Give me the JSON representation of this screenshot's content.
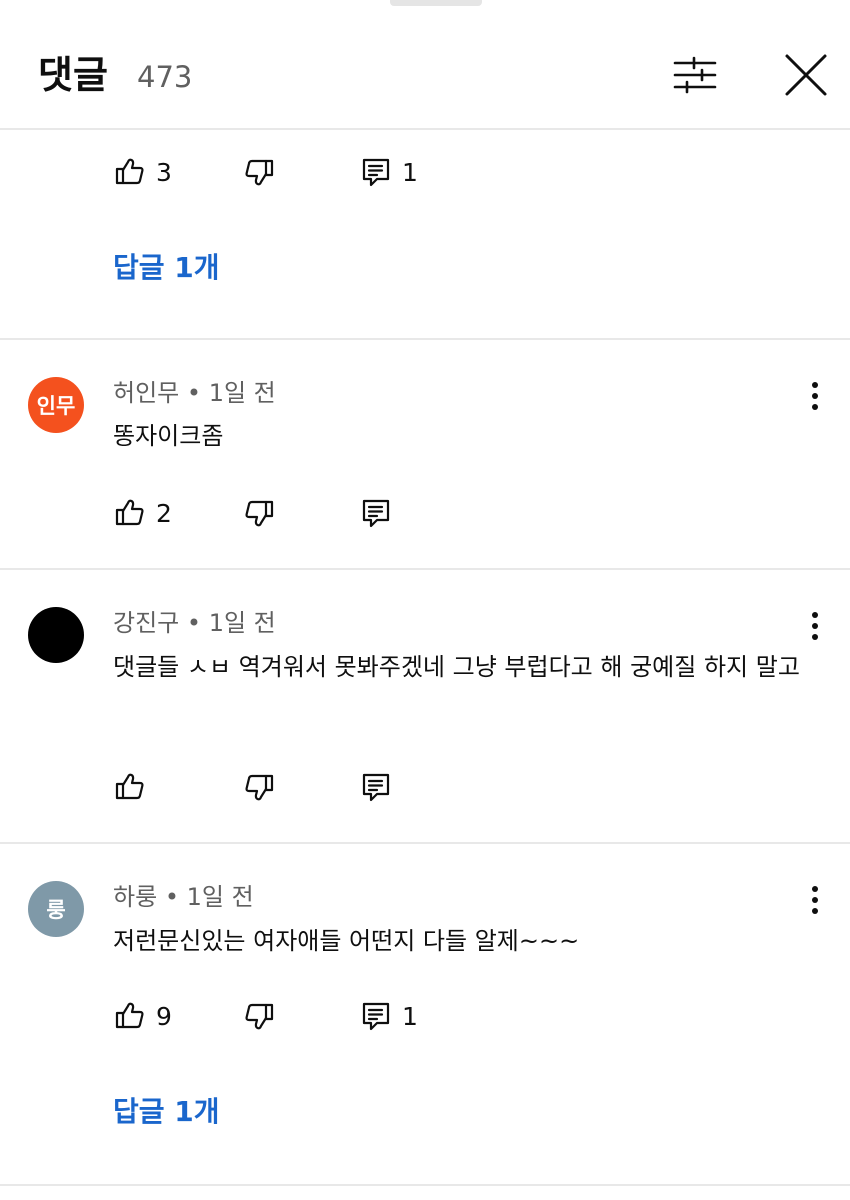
{
  "header": {
    "title": "댓글",
    "count": "473"
  },
  "top_partial": {
    "likes": "3",
    "replies": "1",
    "replies_link": "답글 1개"
  },
  "comments": [
    {
      "initials": "인무",
      "avatar_color": "#f4511e",
      "author": "허인무",
      "time": "1일 전",
      "text": "똥자이크좀",
      "likes": "2",
      "replies": ""
    },
    {
      "initials": "",
      "avatar_color": "#000000",
      "author": "강진구",
      "time": "1일 전",
      "text": "댓글들 ㅅㅂ 역겨워서 못봐주겠네 그냥 부럽다고 해 궁예질 하지 말고",
      "likes": "",
      "replies": ""
    },
    {
      "initials": "룽",
      "avatar_color": "#7f99a8",
      "author": "하룽",
      "time": "1일 전",
      "text": "저런문신있는 여자애들 어떤지 다들 알제~~~",
      "likes": "9",
      "replies": "1",
      "replies_link": "답글 1개"
    }
  ],
  "meta_separator": "•",
  "icons": [
    "filter-icon",
    "close-icon",
    "thumb-up-icon",
    "thumb-down-icon",
    "reply-icon",
    "more-vert-icon"
  ],
  "colors": {
    "link": "#1a66cc",
    "meta": "#606060"
  }
}
